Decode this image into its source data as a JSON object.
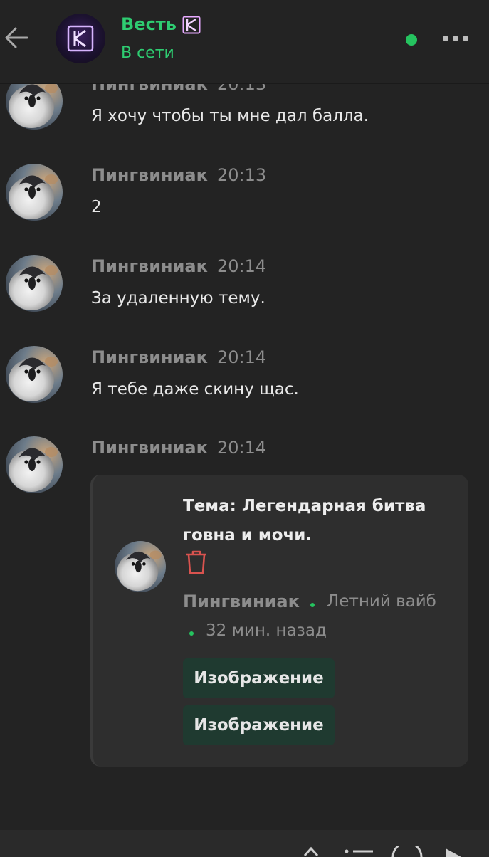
{
  "header": {
    "title": "Весть",
    "status": "В сети"
  },
  "messages": [
    {
      "sender": "Пингвиниак",
      "time": "20:13",
      "text": "Я хочу чтобы ты мне дал балла."
    },
    {
      "sender": "Пингвиниак",
      "time": "20:13",
      "text": "2"
    },
    {
      "sender": "Пингвиниак",
      "time": "20:14",
      "text": "За удаленную тему."
    },
    {
      "sender": "Пингвиниак",
      "time": "20:14",
      "text": "Я тебе даже скину щас."
    },
    {
      "sender": "Пингвиниак",
      "time": "20:14",
      "text": ""
    }
  ],
  "topic_card": {
    "title": "Тема: Легендарная битва говна и мочи.",
    "author": "Пингвиниак",
    "category": "Летний вайб",
    "time_ago": "32 мин. назад",
    "buttons": [
      "Изображение",
      "Изображение"
    ]
  },
  "colors": {
    "background": "#232323",
    "accent_green": "#2ecc71",
    "muted_text": "#8d8d8d",
    "card_bg": "#2e2e2e",
    "button_bg": "#1f3a30",
    "trash_red": "#d9534f"
  }
}
